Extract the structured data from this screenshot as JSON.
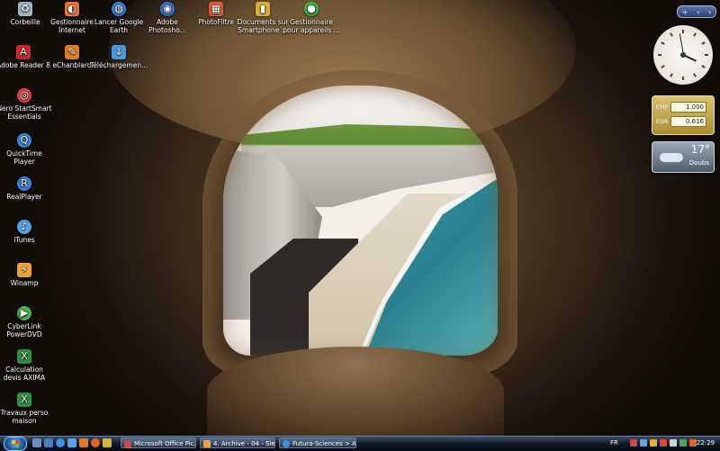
{
  "desktop": {
    "icons": [
      {
        "label": "Corbeille",
        "icon": "recycle-bin-icon",
        "color": "#9fb3c8",
        "glyph": "♻"
      },
      {
        "label": "Gestionnaire Internet",
        "icon": "internet-manager-icon",
        "color": "#e8743a",
        "glyph": "◐"
      },
      {
        "label": "Lancer Google Earth",
        "icon": "google-earth-icon",
        "color": "#3a7fd8",
        "glyph": "◍"
      },
      {
        "label": "Adobe Photosho...",
        "icon": "photoshop-icon",
        "color": "#3a6fd0",
        "glyph": "◉"
      },
      {
        "label": "PhotoFiltre",
        "icon": "photofiltre-icon",
        "color": "#e05a3a",
        "glyph": "▦"
      },
      {
        "label": "Documents sur Smartphone ...",
        "icon": "smartphone-documents-icon",
        "color": "#d9b13a",
        "glyph": "▮"
      },
      {
        "label": "Gestionnaire pour appareils ...",
        "icon": "device-manager-icon",
        "color": "#3fb24a",
        "glyph": "●"
      },
      {
        "label": "Adobe Reader 8",
        "icon": "adobe-reader-icon",
        "color": "#c92b2b",
        "glyph": "A"
      },
      {
        "label": "eChanblard",
        "icon": "echanblard-icon",
        "color": "#e07b2a",
        "glyph": "✎"
      },
      {
        "label": "Téléchargemen...",
        "icon": "downloads-icon",
        "color": "#4a9ae0",
        "glyph": "⇓"
      },
      {
        "label": "Nero StartSmart Essentials",
        "icon": "nero-icon",
        "color": "#e24343",
        "glyph": "◎"
      },
      {
        "label": "QuickTime Player",
        "icon": "quicktime-icon",
        "color": "#3d86d6",
        "glyph": "Q"
      },
      {
        "label": "RealPlayer",
        "icon": "realplayer-icon",
        "color": "#3a7fd8",
        "glyph": "R"
      },
      {
        "label": "iTunes",
        "icon": "itunes-icon",
        "color": "#5aa0e6",
        "glyph": "♪"
      },
      {
        "label": "Winamp",
        "icon": "winamp-icon",
        "color": "#e7a53a",
        "glyph": "⚡"
      },
      {
        "label": "CyberLink PowerDVD",
        "icon": "powerdvd-icon",
        "color": "#4fb04a",
        "glyph": "▶"
      },
      {
        "label": "Calculation devis AXIMA",
        "icon": "excel-icon",
        "color": "#2f8f3f",
        "glyph": "X"
      },
      {
        "label": "Travaux perso maison",
        "icon": "excel-icon",
        "color": "#2f8f3f",
        "glyph": "X"
      }
    ]
  },
  "sidebar": {
    "controls": [
      "+",
      "‹",
      "›"
    ],
    "currency": {
      "from_code": "CHF",
      "from_value": "1.000",
      "to_code": "EUR",
      "to_value": "0.616"
    },
    "weather": {
      "temperature": "17°",
      "city": "Doubs"
    }
  },
  "taskbar": {
    "quick_launch": [
      {
        "icon": "show-desktop-icon",
        "color": "#6b8fc4"
      },
      {
        "icon": "switch-windows-icon",
        "color": "#4a7fbf"
      },
      {
        "icon": "internet-explorer-icon",
        "color": "#3b8fe6"
      },
      {
        "icon": "mail-icon",
        "color": "#5aa0e6"
      },
      {
        "icon": "media-player-icon",
        "color": "#e07b2a"
      },
      {
        "icon": "firefox-icon",
        "color": "#e0652a"
      },
      {
        "icon": "folder-icon",
        "color": "#d9b13a"
      }
    ],
    "tasks": [
      {
        "label": "Microsoft Office Pic...",
        "icon": "office-picture-icon",
        "color": "#c94a4a"
      },
      {
        "label": "4. Archive - 04 - Slee...",
        "icon": "winamp-task-icon",
        "color": "#e7a53a"
      },
      {
        "label": "Futura-Sciences > A...",
        "icon": "firefox-task-icon",
        "color": "#3b8fe6"
      }
    ],
    "tray": {
      "language": "FR",
      "icons": [
        {
          "icon": "security-icon",
          "color": "#c94a4a"
        },
        {
          "icon": "network-icon",
          "color": "#6fa3d8"
        },
        {
          "icon": "update-icon",
          "color": "#e0b23a"
        },
        {
          "icon": "antivirus-icon",
          "color": "#d94a3a"
        },
        {
          "icon": "volume-icon",
          "color": "#c9d3dc"
        },
        {
          "icon": "power-icon",
          "color": "#5aa05a"
        },
        {
          "icon": "shield-icon",
          "color": "#e0652a"
        }
      ],
      "time": "22:29"
    }
  }
}
